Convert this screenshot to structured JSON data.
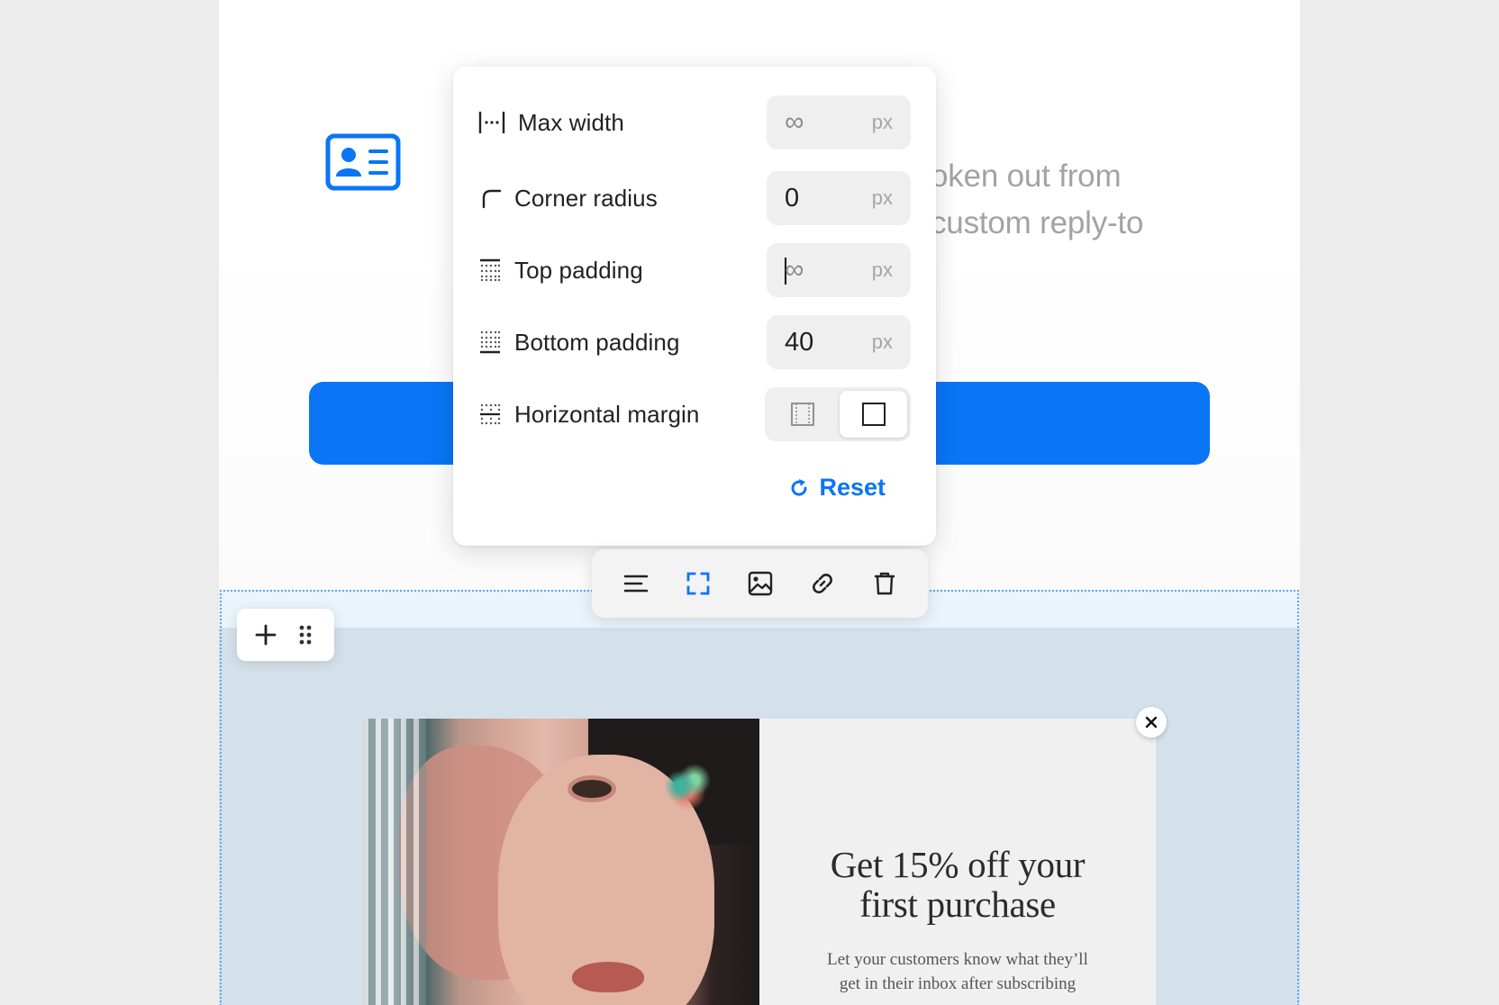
{
  "email_content": {
    "partial_text_line1": "oken out from",
    "partial_text_line2": "custom reply-to"
  },
  "settings_panel": {
    "max_width": {
      "label": "Max width",
      "value": "∞",
      "unit": "px"
    },
    "corner_radius": {
      "label": "Corner radius",
      "value": "0",
      "unit": "px"
    },
    "top_padding": {
      "label": "Top padding",
      "value": "∞",
      "unit": "px"
    },
    "bottom_padding": {
      "label": "Bottom padding",
      "value": "40",
      "unit": "px"
    },
    "horizontal_margin": {
      "label": "Horizontal margin",
      "selected": "none"
    },
    "reset_label": "Reset"
  },
  "toolbar": {
    "buttons": [
      "align-icon",
      "expand-icon",
      "image-icon",
      "link-icon",
      "trash-icon"
    ],
    "active": "expand-icon"
  },
  "popup": {
    "headline_line1": "Get 15% off your",
    "headline_line2": "first purchase",
    "subtext_line1": "Let your customers know what they’ll",
    "subtext_line2": "get in their inbox after subscribing"
  },
  "colors": {
    "accent": "#0a75f5",
    "selection_outline": "#5da7ea",
    "block_background": "#d4e1eb"
  }
}
